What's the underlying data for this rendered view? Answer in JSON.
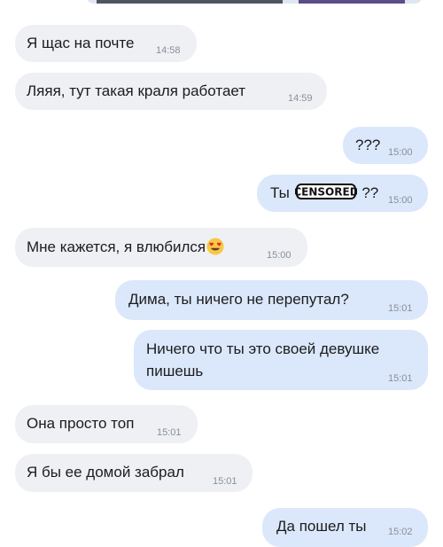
{
  "chat": {
    "messages": [
      {
        "direction": "incoming",
        "text": "Я щас на почте",
        "time": "14:58"
      },
      {
        "direction": "incoming",
        "text": "Ляяя, тут такая краля работает",
        "time": "14:59"
      },
      {
        "direction": "outgoing",
        "text": "???",
        "time": "15:00"
      },
      {
        "direction": "outgoing",
        "text_before": "Ты",
        "censor_label": "CENSORED",
        "text_after": "??",
        "time": "15:00"
      },
      {
        "direction": "incoming",
        "text": "Мне кажется, я влюбился",
        "emoji": "heart-eyes-emoji",
        "time": "15:00"
      },
      {
        "direction": "outgoing",
        "text": "Дима, ты ничего не перепутал?",
        "time": "15:01"
      },
      {
        "direction": "outgoing",
        "line1": "Ничего что ты это своей девушке",
        "line2": "пишешь",
        "time": "15:01"
      },
      {
        "direction": "incoming",
        "text": "Она просто топ",
        "time": "15:01"
      },
      {
        "direction": "incoming",
        "text": "Я бы ее домой забрал",
        "time": "15:01"
      },
      {
        "direction": "outgoing",
        "text": "Да пошел ты",
        "time": "15:02"
      }
    ]
  },
  "colors": {
    "incoming_bubble": "#eef0f4",
    "outgoing_bubble": "#dbe7fb",
    "text": "#1c1c1c",
    "timestamp": "#8a8f98"
  }
}
